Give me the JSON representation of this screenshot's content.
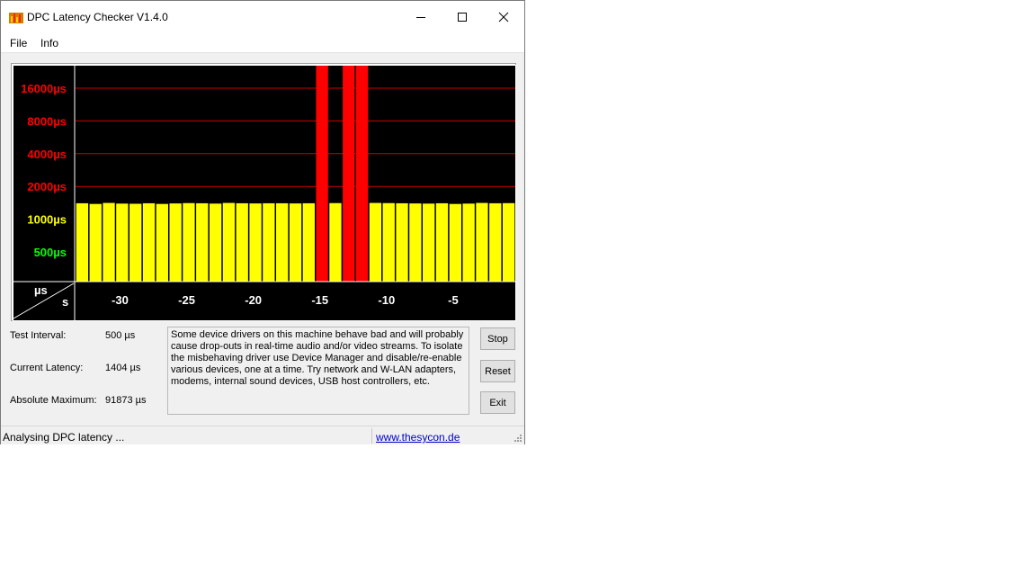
{
  "window": {
    "title": "DPC Latency Checker V1.4.0",
    "controls": [
      "minimize",
      "maximize",
      "close"
    ]
  },
  "menu": {
    "items": [
      {
        "label": "File"
      },
      {
        "label": "Info"
      }
    ]
  },
  "chart_data": {
    "type": "bar",
    "ylabel": "µs",
    "xlabel": "s",
    "y_tick_labels": [
      {
        "label": "16000µs",
        "value": 16000,
        "color": "#ff0000"
      },
      {
        "label": "8000µs",
        "value": 8000,
        "color": "#ff0000"
      },
      {
        "label": "4000µs",
        "value": 4000,
        "color": "#ff0000"
      },
      {
        "label": "2000µs",
        "value": 2000,
        "color": "#ff0000"
      },
      {
        "label": "1000µs",
        "value": 1000,
        "color": "#ffff00"
      },
      {
        "label": "500µs",
        "value": 500,
        "color": "#00ff00"
      }
    ],
    "x_tick_labels": [
      {
        "label": "-30",
        "value": -30
      },
      {
        "label": "-25",
        "value": -25
      },
      {
        "label": "-20",
        "value": -20
      },
      {
        "label": "-15",
        "value": -15
      },
      {
        "label": "-10",
        "value": -10
      },
      {
        "label": "-5",
        "value": -5
      }
    ],
    "xlim": [
      -33,
      0
    ],
    "yscale": "log",
    "grid": "horizontal lines at 2000, 4000, 8000, 16000 µs",
    "x": [
      -32.5,
      -31.5,
      -30.5,
      -29.5,
      -28.5,
      -27.5,
      -26.5,
      -25.5,
      -24.5,
      -23.5,
      -22.5,
      -21.5,
      -20.5,
      -19.5,
      -18.5,
      -17.5,
      -16.5,
      -15.5,
      -14.5,
      -13.5,
      -12.5,
      -11.5,
      -10.5,
      -9.5,
      -8.5,
      -7.5,
      -6.5,
      -5.5,
      -4.5,
      -3.5,
      -2.5,
      -1.5,
      -0.5
    ],
    "values": [
      1400,
      1380,
      1410,
      1390,
      1385,
      1400,
      1380,
      1395,
      1405,
      1400,
      1390,
      1410,
      1400,
      1395,
      1400,
      1400,
      1395,
      1400,
      91873,
      1405,
      91873,
      91873,
      1410,
      1405,
      1400,
      1395,
      1390,
      1400,
      1380,
      1390,
      1410,
      1400,
      1404
    ],
    "colors": {
      "normal": "#ffff00",
      "exceeded": "#ff0000",
      "background": "#000000",
      "gridline": "#cc0000"
    }
  },
  "stats": {
    "test_interval": {
      "label": "Test Interval:",
      "value": "500 µs"
    },
    "current_latency": {
      "label": "Current Latency:",
      "value": "1404 µs"
    },
    "absolute_maximum": {
      "label": "Absolute Maximum:",
      "value": "91873 µs"
    }
  },
  "message": "Some device drivers on this machine behave bad and will probably\ncause drop-outs in real-time audio and/or video streams. To isolate\nthe misbehaving driver use Device Manager and disable/re-enable\nvarious devices, one at a time. Try network and W-LAN adapters,\nmodems, internal sound devices, USB host controllers, etc.",
  "buttons": {
    "stop": "Stop",
    "reset": "Reset",
    "exit": "Exit"
  },
  "status": {
    "text": "Analysing DPC latency ...",
    "link": "www.thesycon.de"
  }
}
